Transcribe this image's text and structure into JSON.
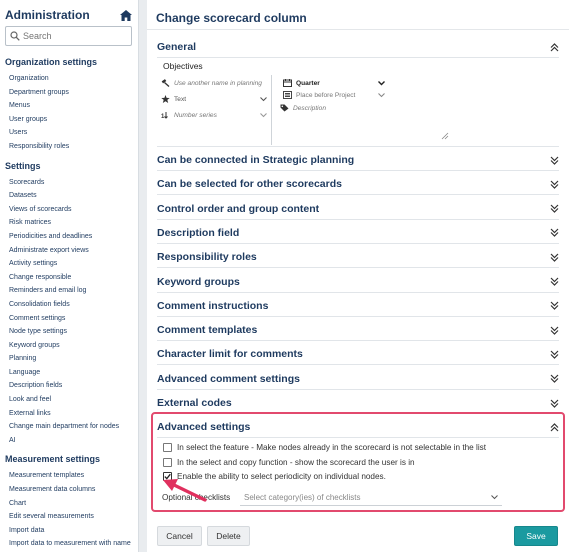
{
  "sidebar": {
    "title": "Administration",
    "search_placeholder": "Search",
    "sections": [
      {
        "title": "Organization settings",
        "items": [
          "Organization",
          "Department groups",
          "Menus",
          "User groups",
          "Users",
          "Responsibility roles"
        ]
      },
      {
        "title": "Settings",
        "items": [
          "Scorecards",
          "Datasets",
          "Views of scorecards",
          "Risk matrices",
          "Periodicities and deadlines",
          "Administrate export views",
          "Activity settings",
          "Change responsible",
          "Reminders and email log",
          "Consolidation fields",
          "Comment settings",
          "Node type settings",
          "Keyword groups",
          "Planning",
          "Language",
          "Description fields",
          "Look and feel",
          "External links",
          "Change main department for nodes",
          "AI"
        ]
      },
      {
        "title": "Measurement settings",
        "items": [
          "Measurement templates",
          "Measurement data columns",
          "Chart",
          "Edit several measurements",
          "Import data",
          "Import data to measurement with name"
        ]
      }
    ]
  },
  "main": {
    "title": "Change scorecard column",
    "general": {
      "label": "General",
      "name_value": "Objectives",
      "alt_name_placeholder": "Use another name in planning",
      "icon_value": "Text",
      "number_series_placeholder": "Number series",
      "period_value": "Quarter",
      "placement_value": "Place before Project",
      "description_placeholder": "Description"
    },
    "sections": [
      "Can be connected in Strategic planning",
      "Can be selected for other scorecards",
      "Control order and group content",
      "Description field",
      "Responsibility roles",
      "Keyword groups",
      "Comment instructions",
      "Comment templates",
      "Character limit for comments",
      "Advanced comment settings",
      "External codes"
    ],
    "advanced": {
      "label": "Advanced settings",
      "options": [
        {
          "label": "In select the feature - Make nodes already in the scorecard is not selectable in the list",
          "checked": false
        },
        {
          "label": "In the select and copy function - show the scorecard the user is in",
          "checked": false
        },
        {
          "label": "Enable the ability to select periodicity on individual nodes.",
          "checked": true
        }
      ],
      "checklists_label": "Optional checklists",
      "checklists_placeholder": "Select category(ies) of checklists"
    },
    "buttons": {
      "cancel": "Cancel",
      "delete": "Delete",
      "save": "Save"
    }
  },
  "colors": {
    "primary_text": "#1e3a5f",
    "highlight": "#e24a6e",
    "save": "#1b9aa0"
  }
}
